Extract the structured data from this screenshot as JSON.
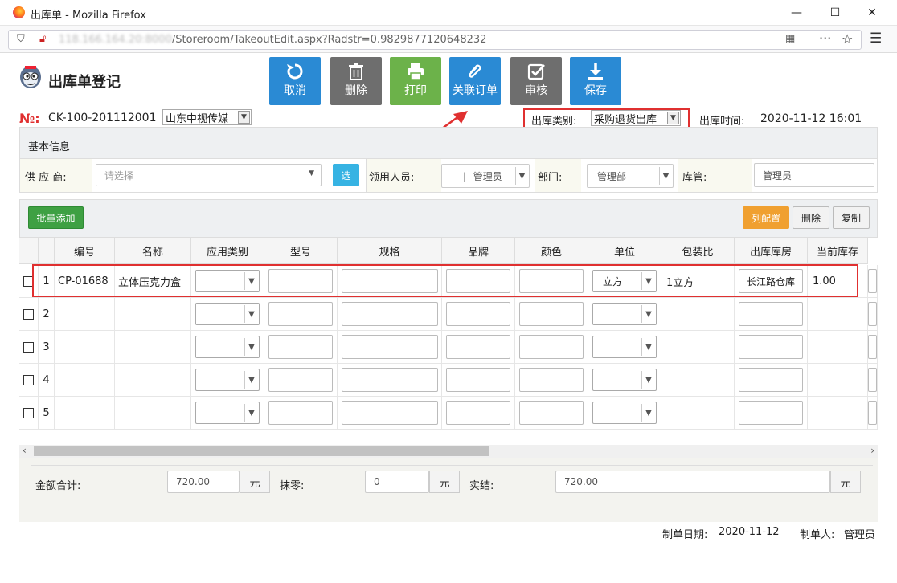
{
  "window": {
    "title": "出库单 - Mozilla Firefox"
  },
  "browser": {
    "url_hidden": "118.166.164.20:8000",
    "url_path": "/Storeroom/TakeoutEdit.aspx?Radstr=0.9829877120648232"
  },
  "header": {
    "title": "出库单登记"
  },
  "toolbar": {
    "cancel": "取消",
    "delete": "删除",
    "print": "打印",
    "link_order": "关联订单",
    "audit": "审核",
    "save": "保存"
  },
  "doc": {
    "no_label": "№:",
    "no_value": "CK-100-201112001",
    "company": "山东中视传媒",
    "type_label": "出库类别:",
    "type_value": "采购退货出库",
    "time_label": "出库时间:",
    "time_value": "2020-11-12 16:01"
  },
  "basic": {
    "section_title": "基本信息",
    "supplier_label": "供 应 商:",
    "supplier_placeholder": "请选择",
    "pick_button": "选",
    "receiver_label": "领用人员:",
    "receiver_value": "|--管理员",
    "dept_label": "部门:",
    "dept_value": "管理部",
    "keeper_label": "库管:",
    "keeper_value": "管理员"
  },
  "grid_actions": {
    "batch_add": "批量添加",
    "col_config": "列配置",
    "delete": "删除",
    "copy": "复制"
  },
  "grid": {
    "columns": [
      "编号",
      "名称",
      "应用类别",
      "型号",
      "规格",
      "品牌",
      "颜色",
      "单位",
      "包装比",
      "出库库房",
      "当前库存"
    ],
    "rows": [
      {
        "num": "1",
        "code": "CP-01688",
        "name": "立体压克力盒",
        "unit": "立方",
        "pack": "1立方",
        "room": "长江路仓库",
        "stock": "1.00"
      },
      {
        "num": "2",
        "code": "",
        "name": "",
        "unit": "",
        "pack": "",
        "room": "",
        "stock": ""
      },
      {
        "num": "3",
        "code": "",
        "name": "",
        "unit": "",
        "pack": "",
        "room": "",
        "stock": ""
      },
      {
        "num": "4",
        "code": "",
        "name": "",
        "unit": "",
        "pack": "",
        "room": "",
        "stock": ""
      },
      {
        "num": "5",
        "code": "",
        "name": "",
        "unit": "",
        "pack": "",
        "room": "",
        "stock": ""
      }
    ]
  },
  "totals": {
    "total_label": "金额合计:",
    "total_value": "720.00",
    "yuan": "元",
    "round_label": "抹零:",
    "round_value": "0",
    "final_label": "实结:",
    "final_value": "720.00"
  },
  "footer": {
    "date_label": "制单日期:",
    "date_value": "2020-11-12",
    "maker_label": "制单人:",
    "maker_value": "管理员"
  },
  "colors": {
    "accent_red": "#e03030",
    "blue_button": "#2a8ad4",
    "green_button": "#6cb24a",
    "orange_button": "#f0a030"
  }
}
